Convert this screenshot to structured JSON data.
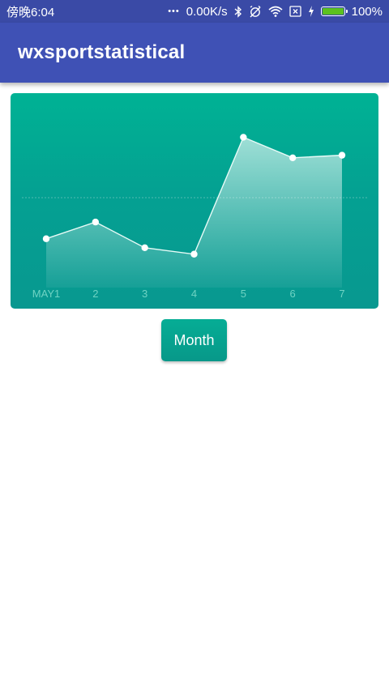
{
  "status_bar": {
    "time": "傍晚6:04",
    "net_dots": "•••",
    "net_speed": "0.00K/s",
    "battery_percent": "100%",
    "battery_level": 1.0,
    "icons": [
      "bluetooth-icon",
      "alarm-off-icon",
      "wifi-icon",
      "sim-card-icon",
      "charging-icon",
      "battery-icon"
    ]
  },
  "app_bar": {
    "title": "wxsportstatistical"
  },
  "chart_data": {
    "type": "area",
    "categories": [
      "MAY1",
      "2",
      "3",
      "4",
      "5",
      "6",
      "7"
    ],
    "values": [
      38,
      51,
      31,
      26,
      117,
      101,
      103
    ],
    "ylim": [
      0,
      145
    ],
    "reference_line": 70,
    "grid": false,
    "legend": "none",
    "colors": {
      "background_top": "#00b294",
      "background_bottom": "#089890",
      "line": "#e8fbf7",
      "point": "#ffffff",
      "axis_label": "#6fd3c3"
    }
  },
  "button": {
    "label": "Month"
  }
}
